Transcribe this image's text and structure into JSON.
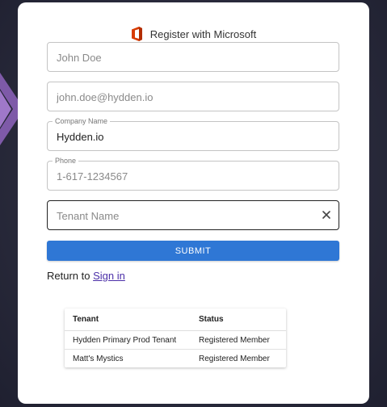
{
  "colors": {
    "accent": "#2f77d5",
    "link": "#4b2fa8",
    "office": "#d83b01"
  },
  "header": {
    "icon": "office-icon",
    "title": "Register with Microsoft"
  },
  "form": {
    "name": {
      "value": "",
      "placeholder": "John Doe"
    },
    "email": {
      "value": "",
      "placeholder": "john.doe@hydden.io"
    },
    "company": {
      "label": "Company Name",
      "value": "Hydden.io"
    },
    "phone": {
      "label": "Phone",
      "value": "",
      "placeholder": "1-617-1234567"
    },
    "tenant": {
      "value": "",
      "placeholder": "Tenant Name",
      "clear_icon": "close-icon"
    },
    "submit_label": "SUBMIT"
  },
  "return": {
    "text": "Return to",
    "link_label": "Sign in"
  },
  "tenants_table": {
    "columns": [
      "Tenant",
      "Status"
    ],
    "rows": [
      [
        "Hydden Primary Prod Tenant",
        "Registered Member"
      ],
      [
        "Matt's Mystics",
        "Registered Member"
      ]
    ]
  }
}
